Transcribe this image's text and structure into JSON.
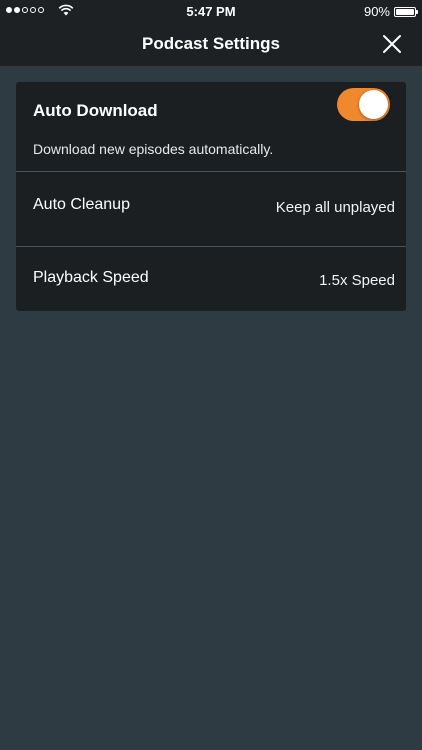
{
  "status_bar": {
    "time": "5:47 PM",
    "battery_text": "90%",
    "battery_level": 0.9,
    "signal_bars_filled": 2,
    "signal_bars_total": 5,
    "icons": [
      "signal-dots-icon",
      "wifi-icon",
      "battery-icon"
    ]
  },
  "nav": {
    "title": "Podcast Settings",
    "close_icon": "close-icon"
  },
  "settings": {
    "auto_download": {
      "title": "Auto Download",
      "description": "Download new episodes automatically.",
      "enabled": true
    },
    "auto_cleanup": {
      "label": "Auto Cleanup",
      "value": "Keep all unplayed"
    },
    "playback_speed": {
      "label": "Playback Speed",
      "value": "1.5x Speed"
    }
  },
  "colors": {
    "background": "#2f3b42",
    "bar": "#1d2124",
    "card": "#1b1f22",
    "accent": "#f0892e",
    "divider": "#4a545a"
  }
}
